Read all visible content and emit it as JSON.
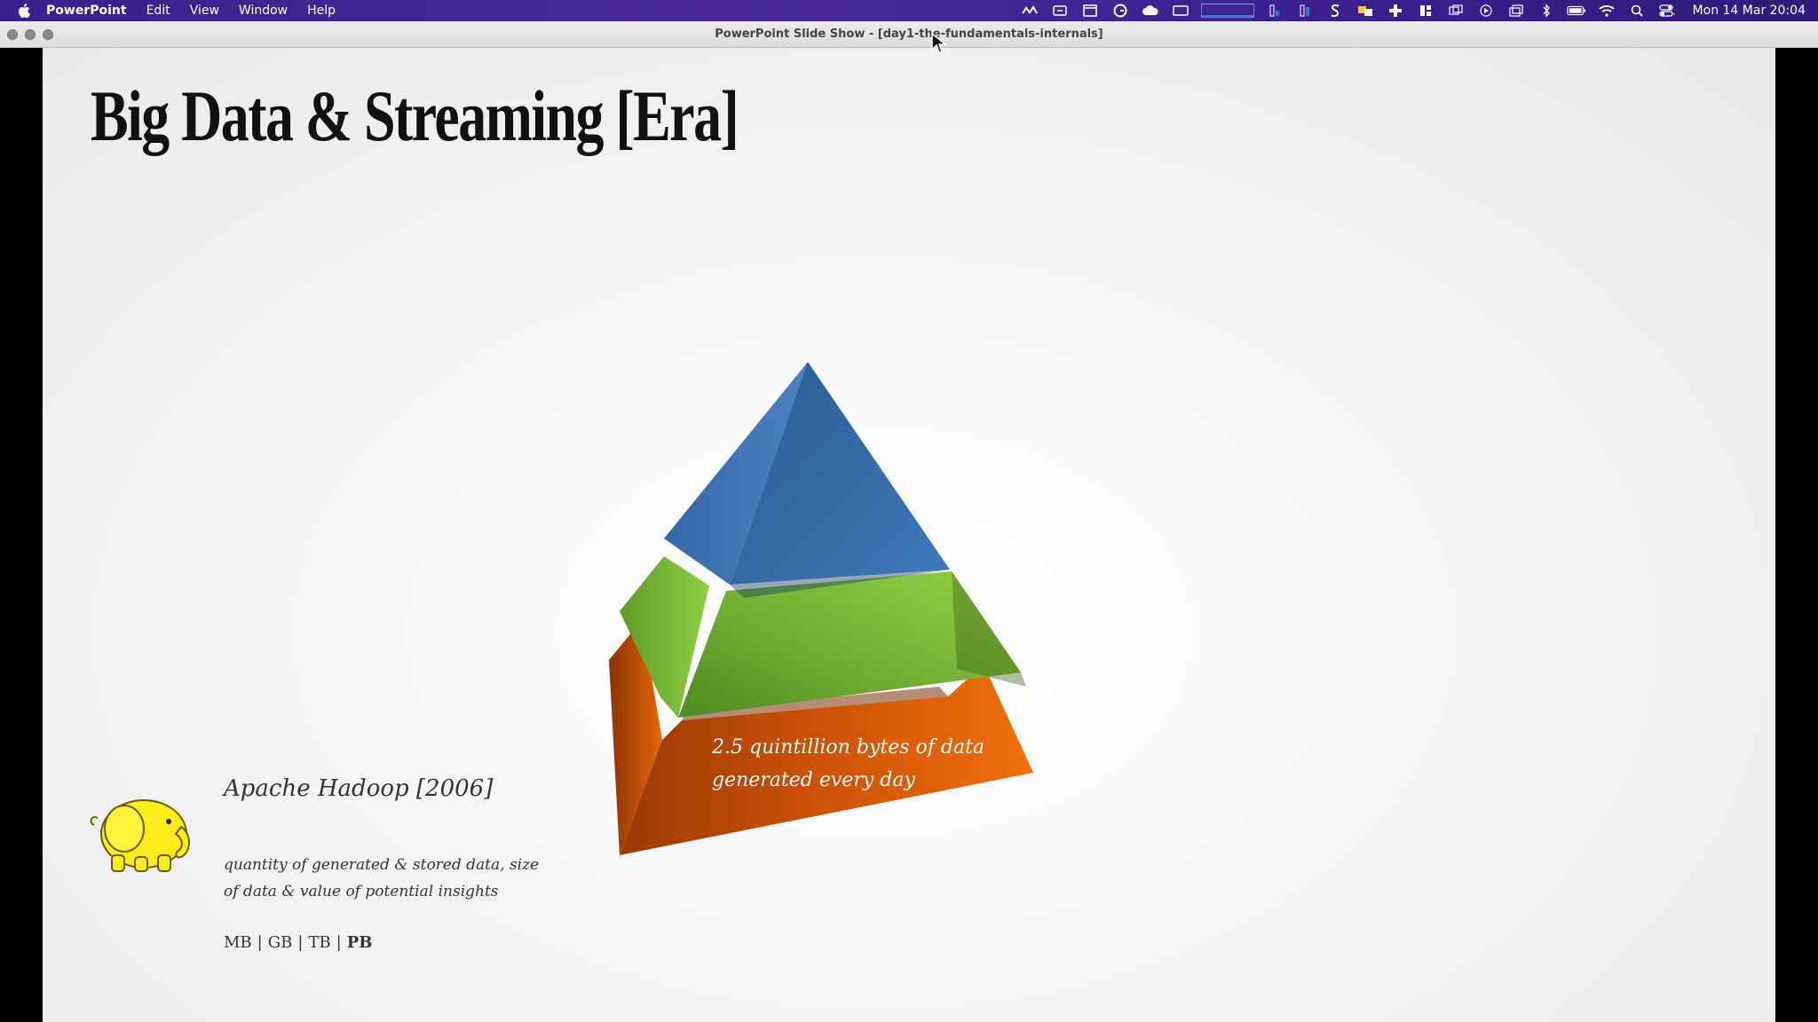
{
  "menubar": {
    "app_name": "PowerPoint",
    "menus": [
      "Edit",
      "View",
      "Window",
      "Help"
    ],
    "clock": "Mon 14 Mar  20:04",
    "status_icons": [
      "wifi-icon",
      "search-icon",
      "control-center-icon",
      "battery-icon",
      "bluetooth-icon"
    ]
  },
  "window": {
    "title": "PowerPoint Slide Show - [day1-the-fundamentals-internals]"
  },
  "slide": {
    "title": "Big Data & Streaming [Era]",
    "pyramid_label_line1": "2.5 quintillion bytes of data",
    "pyramid_label_line2": "generated every day",
    "pyramid_colors": {
      "top": "#3c72b0",
      "middle": "#7cbd3c",
      "bottom": "#e0620a"
    },
    "hadoop_title": "Apache Hadoop [2006]",
    "hadoop_desc_line1": "quantity of generated & stored data, size",
    "hadoop_desc_line2": "of data & value of potential insights",
    "units": [
      "MB",
      "GB",
      "TB",
      "PB"
    ]
  }
}
